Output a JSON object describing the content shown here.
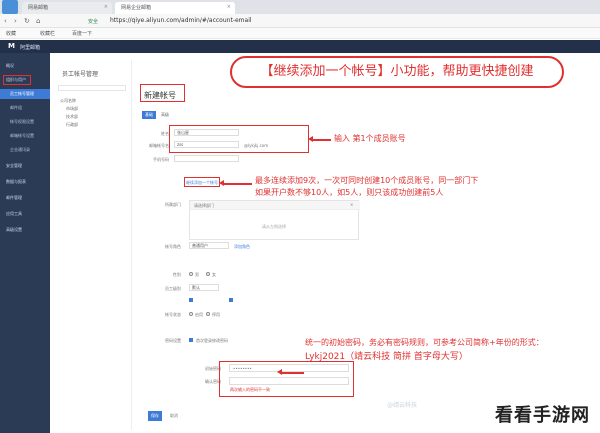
{
  "browser": {
    "tabs": [
      {
        "label": "网易邮箱"
      },
      {
        "label": "网易企业邮箱"
      }
    ],
    "secure_label": "安全",
    "url": "https://qiye.aliyun.com/admin/#/account-email",
    "bookmarks": [
      "收藏",
      "收藏栏",
      "百度一下"
    ]
  },
  "app": {
    "logo": "M",
    "name": "阿里邮箱"
  },
  "sidebar": {
    "items": [
      {
        "label": "概况"
      },
      {
        "label": "组织与用户"
      },
      {
        "label": "员工帐号管理"
      },
      {
        "label": "邮件组"
      },
      {
        "label": "帐号权限设置"
      },
      {
        "label": "邮箱帐号设置"
      },
      {
        "label": "企业通讯录"
      },
      {
        "label": "安全管理"
      },
      {
        "label": "数据与报表"
      },
      {
        "label": "邮件管理"
      },
      {
        "label": "应用工具"
      },
      {
        "label": "高级设置"
      }
    ]
  },
  "panel": {
    "title": "员工帐号管理",
    "tree": [
      "公司名称",
      "市场部",
      "技术部",
      "行政部"
    ]
  },
  "main": {
    "title": "新建帐号",
    "tabs": [
      "基础",
      "高级"
    ],
    "fields": {
      "name_label": "姓名",
      "name_value": "张山星",
      "email_label": "邮箱帐号名",
      "email_value": "zss",
      "email_domain": "@lykjkj.com",
      "phone_label": "手机号码",
      "add_more_link": "继续添加一个帐号",
      "dept_label": "所属部门",
      "dept_placeholder": "请选择部门",
      "dept_hint": "请从左侧选择",
      "role_label": "帐号角色",
      "role_value": "普通用户",
      "role_link": "添加角色",
      "gender_label": "性别",
      "gender_male": "男",
      "gender_female": "女",
      "level_label": "员工级别",
      "level_default": "默认",
      "status_label": "帐号状态",
      "status_enabled": "启用",
      "status_disabled": "停用",
      "pwd_rule_label": "密码设置",
      "pwd_rule_value": "首次登录修改密码",
      "pwd_label": "初始密码",
      "pwd_value": "••••••••",
      "pwd_confirm_label": "确认密码",
      "pwd_error": "两次输入的密码不一致",
      "submit": "保存",
      "cancel": "取消"
    }
  },
  "annotations": {
    "headline": "【继续添加一个帐号】小功能，帮助更快捷创建",
    "note1": "输入 第1个成员账号",
    "note2_line1": "最多连续添加9次，一次可同时创建10个成员账号，同一部门下",
    "note2_line2": "如果开户数不够10人，如5人，则只该成功创建前5人",
    "note3_line1": "统一的初始密码，务必有密码规则，可参考公司简称+年份的形式：",
    "note3_line2": "Lykj2021（靖云科技 简拼 首字母大写）"
  },
  "watermark": {
    "main": "看看手游网",
    "secondary": "@靖云科技"
  }
}
